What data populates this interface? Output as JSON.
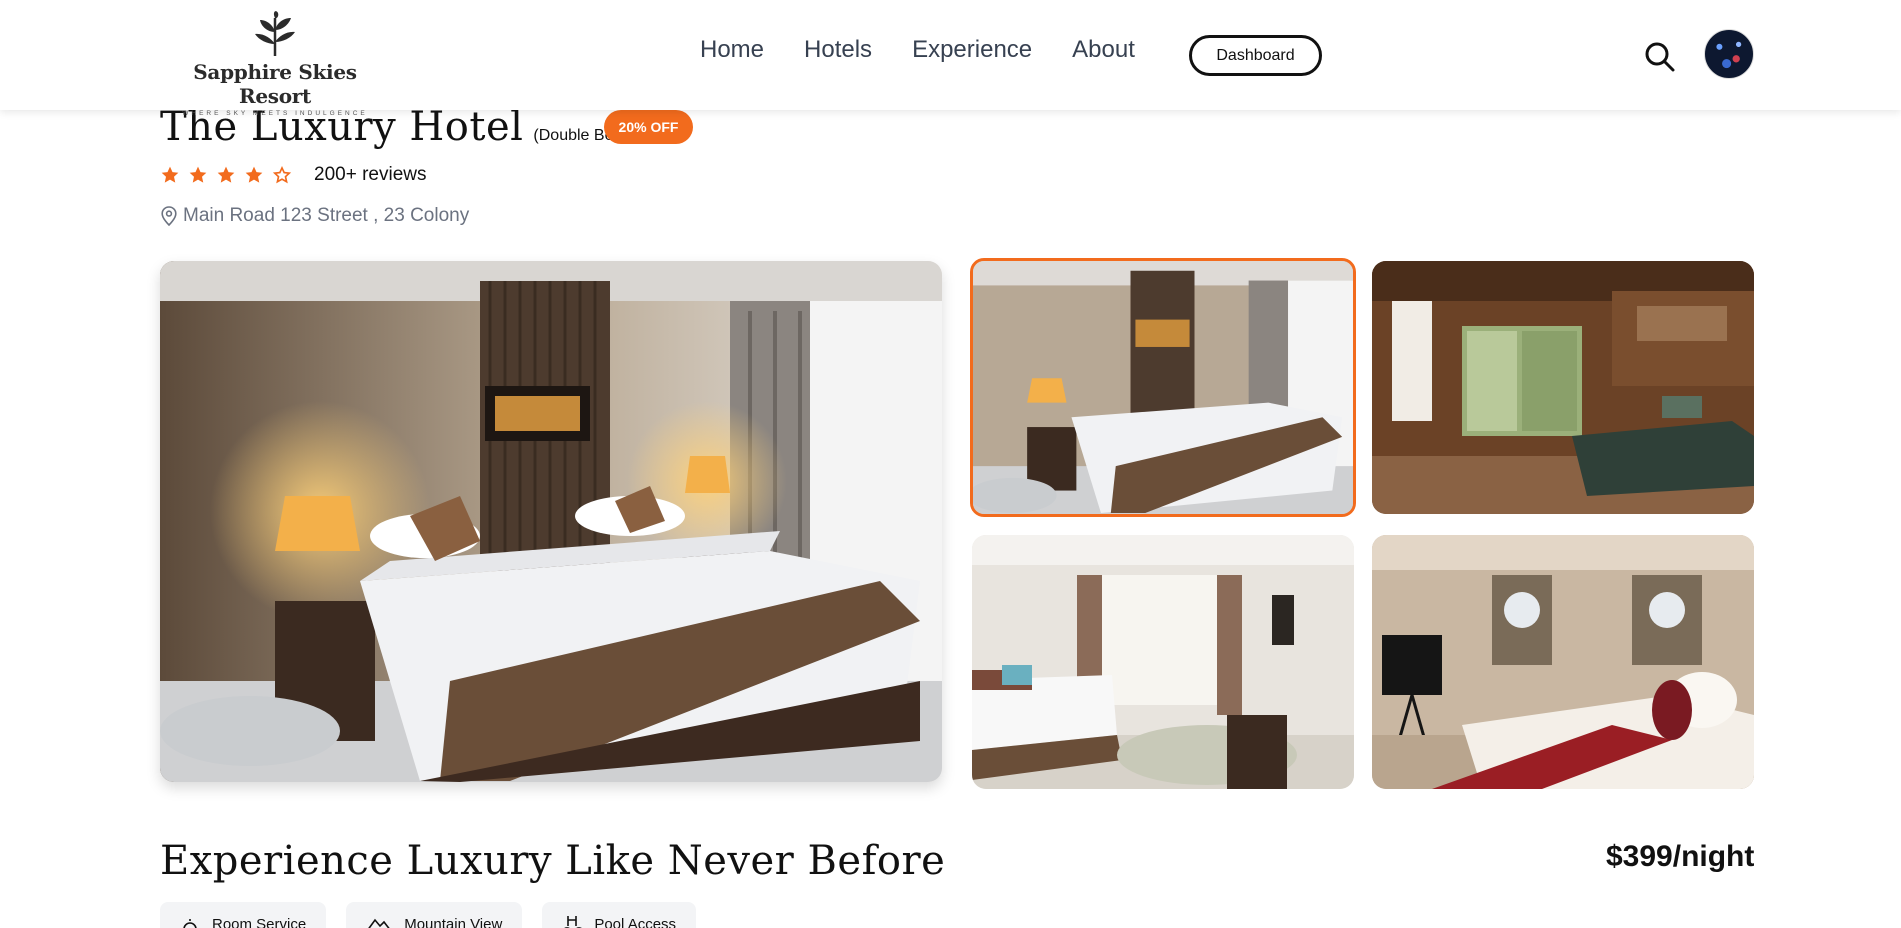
{
  "header": {
    "logo": {
      "name": "Sapphire Skies Resort",
      "tagline": "WHERE SKY MEETS INDULGENCE"
    },
    "nav": [
      {
        "label": "Home"
      },
      {
        "label": "Hotels"
      },
      {
        "label": "Experience"
      },
      {
        "label": "About"
      }
    ],
    "dashboard_label": "Dashboard",
    "search_icon": "search-icon",
    "avatar": "user-avatar"
  },
  "hotel": {
    "title": "The Luxury Hotel",
    "bed_type": "(Double Bed)",
    "discount": "20% OFF",
    "rating": {
      "filled": 4,
      "total": 5
    },
    "reviews": "200+ reviews",
    "address": "Main Road 123 Street , 23 Colony",
    "accent_color": "#f26b1d"
  },
  "gallery": {
    "main": "main-room-photo",
    "thumbnails": [
      "thumbnail-room-1-selected",
      "thumbnail-room-2",
      "thumbnail-room-3",
      "thumbnail-room-4"
    ]
  },
  "details": {
    "heading": "Experience Luxury Like Never Before",
    "price": "$399/night",
    "amenities": [
      {
        "label": "Room Service",
        "icon": "room-service-icon"
      },
      {
        "label": "Mountain View",
        "icon": "mountain-icon"
      },
      {
        "label": "Pool Access",
        "icon": "pool-icon"
      }
    ]
  }
}
